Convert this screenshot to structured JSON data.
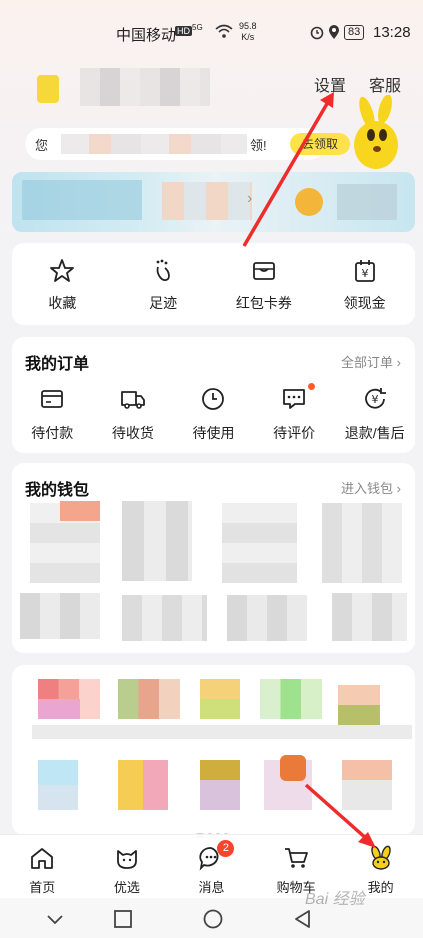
{
  "status_bar": {
    "carrier": "中国移动",
    "hd": "HD",
    "signal": "5G",
    "net_speed": "95.8\nK/s",
    "battery": "83",
    "time": "13:28"
  },
  "header": {
    "settings": "设置",
    "service": "客服",
    "coupon_prefix": "您",
    "coupon_suffix": "领!",
    "coupon_button": "去领取"
  },
  "quick_links": [
    {
      "label": "收藏",
      "icon": "star-icon"
    },
    {
      "label": "足迹",
      "icon": "footprint-icon"
    },
    {
      "label": "红包卡券",
      "icon": "ticket-icon"
    },
    {
      "label": "领现金",
      "icon": "cash-calendar-icon"
    }
  ],
  "orders": {
    "title": "我的订单",
    "all_link": "全部订单 ›",
    "items": [
      {
        "label": "待付款",
        "icon": "card-icon"
      },
      {
        "label": "待收货",
        "icon": "truck-icon"
      },
      {
        "label": "待使用",
        "icon": "clock-icon"
      },
      {
        "label": "待评价",
        "icon": "comment-icon"
      },
      {
        "label": "退款/售后",
        "icon": "refund-icon"
      }
    ]
  },
  "wallet": {
    "title": "我的钱包",
    "enter_link": "进入钱包 ›"
  },
  "tabbar": [
    {
      "label": "首页",
      "icon": "home-icon"
    },
    {
      "label": "优选",
      "icon": "cat-face-icon"
    },
    {
      "label": "消息",
      "icon": "message-icon",
      "badge": "2"
    },
    {
      "label": "购物车",
      "icon": "cart-icon"
    },
    {
      "label": "我的",
      "icon": "profile-mascot-icon"
    }
  ],
  "watermark": "Bai 经验"
}
